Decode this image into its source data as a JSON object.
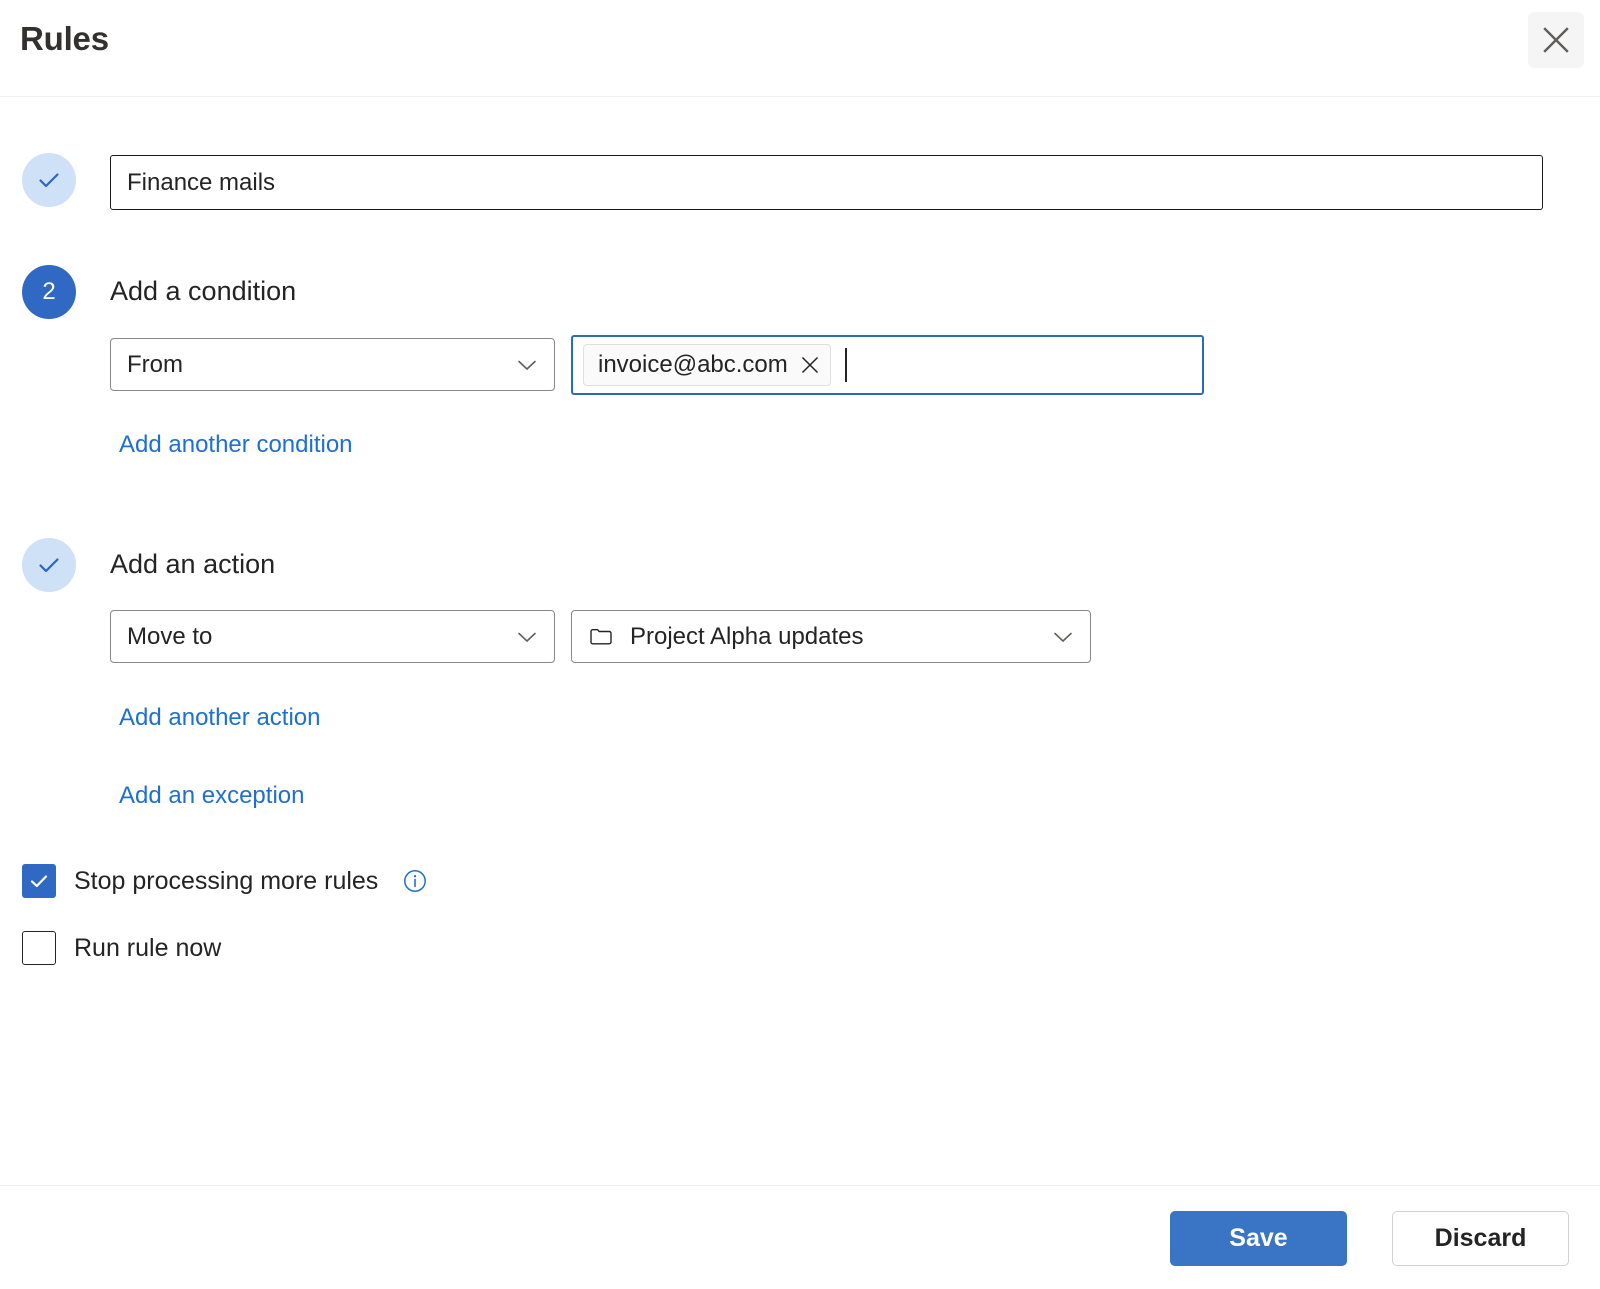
{
  "header": {
    "title": "Rules",
    "close_icon": "close-icon"
  },
  "rule_name": {
    "value": "Finance mails",
    "placeholder": "",
    "marker_icon": "check-icon"
  },
  "condition_section": {
    "step_number": "2",
    "heading": "Add a condition",
    "field_dropdown": {
      "value": "From",
      "chevron_icon": "chevron-down-icon"
    },
    "value_field": {
      "tokens": [
        {
          "label": "invoice@abc.com",
          "remove_icon": "close-icon"
        }
      ]
    },
    "add_link": "Add another condition"
  },
  "action_section": {
    "marker_icon": "check-icon",
    "heading": "Add an action",
    "action_dropdown": {
      "value": "Move to",
      "chevron_icon": "chevron-down-icon"
    },
    "target_dropdown": {
      "value": "Project Alpha updates",
      "leading_icon": "folder-icon",
      "chevron_icon": "chevron-down-icon"
    },
    "add_action_link": "Add another action",
    "add_exception_link": "Add an exception"
  },
  "options": {
    "stop_processing": {
      "label": "Stop processing more rules",
      "checked": true,
      "info_icon": "info-icon"
    },
    "run_now": {
      "label": "Run rule now",
      "checked": false
    }
  },
  "footer": {
    "save_label": "Save",
    "discard_label": "Discard"
  },
  "colors": {
    "accent": "#3069c4",
    "link": "#1f6fd0",
    "marker_done_bg": "#cfe1f7",
    "focus_border": "#2b6cb8",
    "save_bg": "#3a74c4"
  }
}
